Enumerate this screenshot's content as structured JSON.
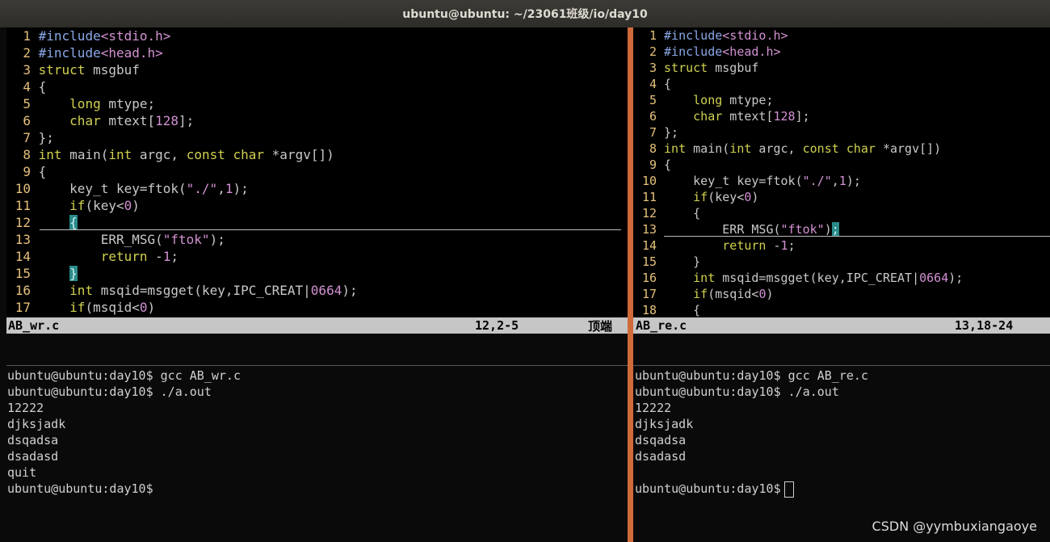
{
  "window": {
    "title": "ubuntu@ubuntu: ~/23061班级/io/day10"
  },
  "left_editor": {
    "lines": [
      {
        "n": "1",
        "html": "<span class=\"pp\">#include</span><span class=\"str\">&lt;stdio.h&gt;</span>"
      },
      {
        "n": "2",
        "html": "<span class=\"pp\">#include</span><span class=\"str\">&lt;head.h&gt;</span>"
      },
      {
        "n": "3",
        "html": "<span class=\"kw\">struct</span> msgbuf"
      },
      {
        "n": "4",
        "html": "{"
      },
      {
        "n": "5",
        "html": "    <span class=\"kw\">long</span> mtype;"
      },
      {
        "n": "6",
        "html": "    <span class=\"kw\">char</span> mtext[<span class=\"num\">128</span>];"
      },
      {
        "n": "7",
        "html": "};"
      },
      {
        "n": "8",
        "html": "<span class=\"kw\">int</span> main(<span class=\"kw\">int</span> argc, <span class=\"kw\">const</span> <span class=\"kw\">char</span> *argv[])"
      },
      {
        "n": "9",
        "html": "{"
      },
      {
        "n": "10",
        "html": "    key_t key=ftok(<span class=\"str\">\"./\"</span>,<span class=\"num\">1</span>);"
      },
      {
        "n": "11",
        "html": "    <span class=\"kw\">if</span>(key&lt;<span class=\"num\">0</span>)"
      },
      {
        "n": "12",
        "html": "    <span class=\"hl\">{</span>"
      },
      {
        "n": "13",
        "html": "        ERR_MSG(<span class=\"str\">\"ftok\"</span>);"
      },
      {
        "n": "14",
        "html": "        <span class=\"kw\">return</span> -<span class=\"num\">1</span>;"
      },
      {
        "n": "15",
        "html": "    <span class=\"hl\">}</span>"
      },
      {
        "n": "16",
        "html": "    <span class=\"kw\">int</span> msqid=msgget(key,IPC_CREAT|<span class=\"num\">0664</span>);"
      },
      {
        "n": "17",
        "html": "    <span class=\"kw\">if</span>(msqid&lt;<span class=\"num\">0</span>)"
      }
    ],
    "status_file": "AB_wr.c",
    "status_pos": "12,2-5",
    "status_scroll": "顶端"
  },
  "right_editor": {
    "lines": [
      {
        "n": "1",
        "html": "<span class=\"pp\">#include</span><span class=\"str\">&lt;stdio.h&gt;</span>"
      },
      {
        "n": "2",
        "html": "<span class=\"pp\">#include</span><span class=\"str\">&lt;head.h&gt;</span>"
      },
      {
        "n": "3",
        "html": "<span class=\"kw\">struct</span> msgbuf"
      },
      {
        "n": "4",
        "html": "{"
      },
      {
        "n": "5",
        "html": "    <span class=\"kw\">long</span> mtype;"
      },
      {
        "n": "6",
        "html": "    <span class=\"kw\">char</span> mtext[<span class=\"num\">128</span>];"
      },
      {
        "n": "7",
        "html": "};"
      },
      {
        "n": "8",
        "html": "<span class=\"kw\">int</span> main(<span class=\"kw\">int</span> argc, <span class=\"kw\">const</span> <span class=\"kw\">char</span> *argv[])"
      },
      {
        "n": "9",
        "html": "{"
      },
      {
        "n": "10",
        "html": "    key_t key=ftok(<span class=\"str\">\"./\"</span>,<span class=\"num\">1</span>);"
      },
      {
        "n": "11",
        "html": "    <span class=\"kw\">if</span>(key&lt;<span class=\"num\">0</span>)"
      },
      {
        "n": "12",
        "html": "    {"
      },
      {
        "n": "13",
        "html": "        ERR_MSG(<span class=\"str\">\"ftok\"</span>)<span class=\"hl\">;</span>"
      },
      {
        "n": "14",
        "html": "        <span class=\"kw\">return</span> -<span class=\"num\">1</span>;"
      },
      {
        "n": "15",
        "html": "    }"
      },
      {
        "n": "16",
        "html": "    <span class=\"kw\">int</span> msqid=msgget(key,IPC_CREAT|<span class=\"num\">0664</span>);"
      },
      {
        "n": "17",
        "html": "    <span class=\"kw\">if</span>(msqid&lt;<span class=\"num\">0</span>)"
      },
      {
        "n": "18",
        "html": "    {"
      }
    ],
    "status_file": "AB_re.c",
    "status_pos": "13,18-24"
  },
  "left_terminal": {
    "lines": [
      "ubuntu@ubuntu:day10$ gcc AB_wr.c",
      "ubuntu@ubuntu:day10$ ./a.out",
      "12222",
      "djksjadk",
      "dsqadsa",
      "dsadasd",
      "quit",
      "ubuntu@ubuntu:day10$"
    ]
  },
  "right_terminal": {
    "lines": [
      "ubuntu@ubuntu:day10$ gcc AB_re.c",
      "ubuntu@ubuntu:day10$ ./a.out",
      "12222",
      "djksjadk",
      "dsqadsa",
      "dsadasd",
      ""
    ],
    "prompt": "ubuntu@ubuntu:day10$"
  },
  "watermark": "CSDN @yymbuxiangaoye"
}
